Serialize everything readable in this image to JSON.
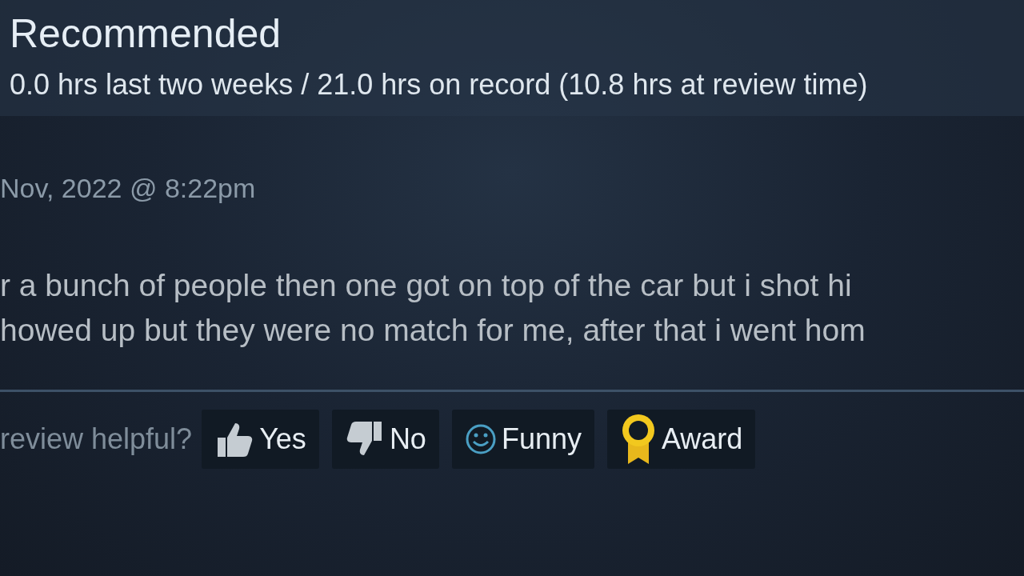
{
  "review": {
    "verdict": "Recommended",
    "hours": "0.0 hrs last two weeks / 21.0 hrs on record (10.8 hrs at review time)",
    "posted": "Nov, 2022 @ 8:22pm",
    "body_lines": [
      "r a bunch of people then one got on top of the car but i shot hi",
      "howed up but they were no match for me, after that i went hom"
    ]
  },
  "helpful": {
    "prompt": "review helpful?",
    "buttons": [
      {
        "kind": "yes",
        "label": "Yes"
      },
      {
        "kind": "no",
        "label": "No"
      },
      {
        "kind": "funny",
        "label": "Funny"
      },
      {
        "kind": "award",
        "label": "Award"
      }
    ]
  }
}
